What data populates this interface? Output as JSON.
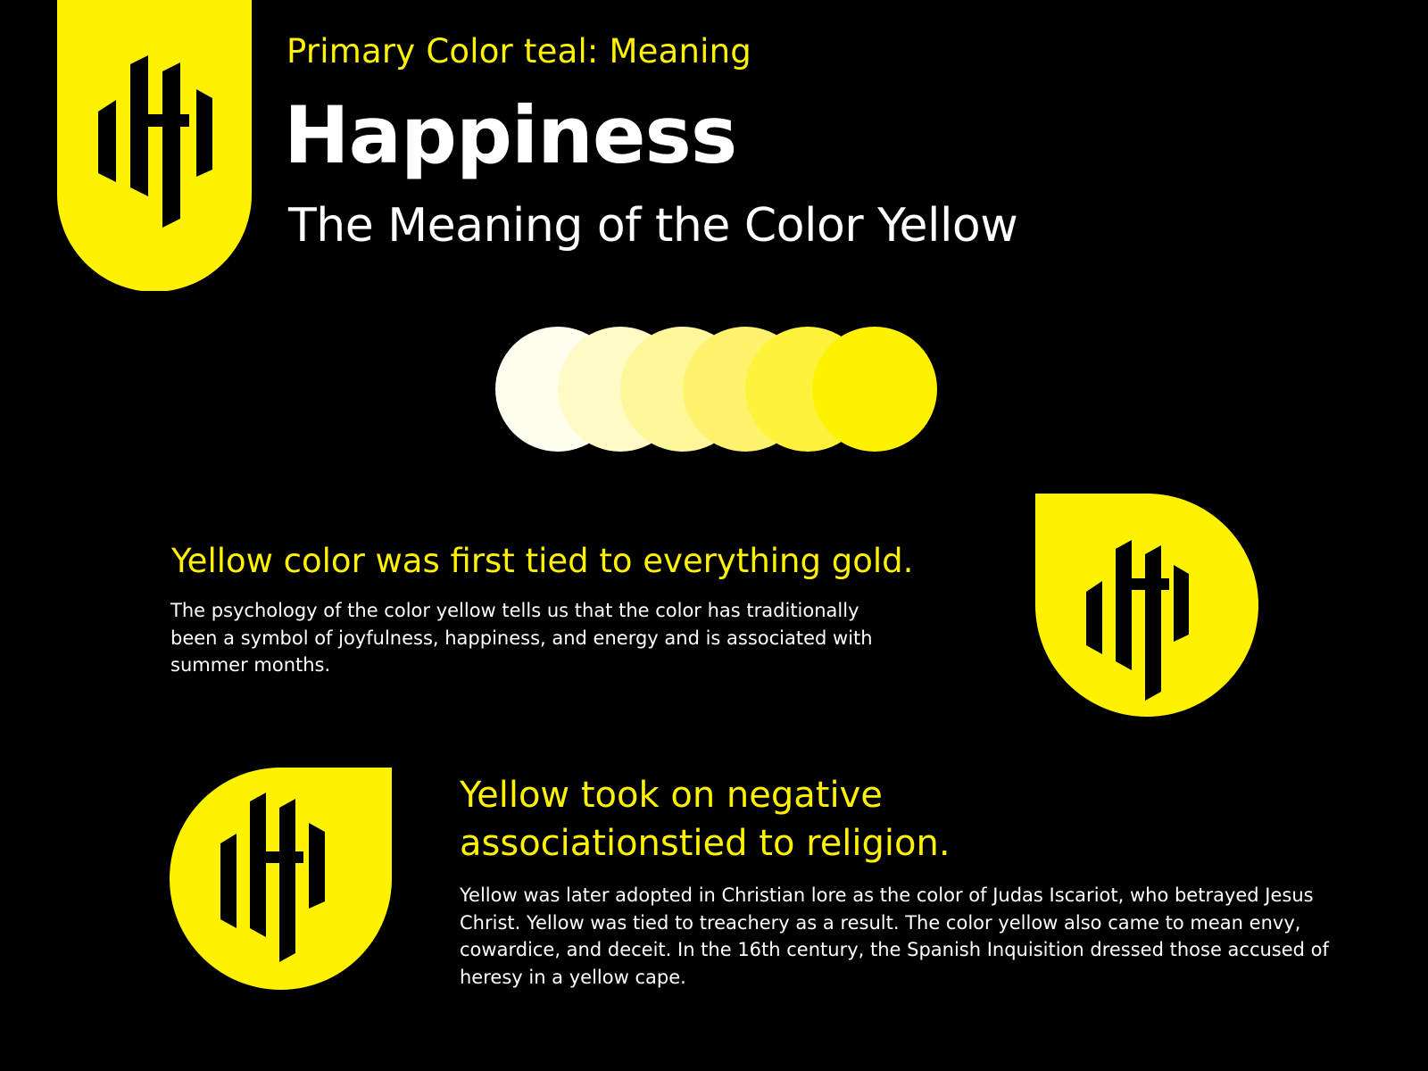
{
  "colors": {
    "accent": "#fff200",
    "background": "#000000",
    "text": "#ffffff"
  },
  "header": {
    "eyebrow": "Primary Color teal: Meaning",
    "title": "Happiness",
    "subtitle": "The Meaning of the Color Yellow"
  },
  "swatches": [
    "#fffded",
    "#fffac6",
    "#fff799",
    "#fff36d",
    "#fff23a",
    "#fff200"
  ],
  "sections": [
    {
      "heading": "Yellow color was first tied to everything gold.",
      "body": "The psychology of the color yellow tells us that the color has traditionally been a symbol of joyfulness, happiness, and energy and is associated with summer months."
    },
    {
      "heading": "Yellow took on negative associationstied to religion.",
      "body": "Yellow was later adopted in Christian lore as the color of Judas Iscariot, who betrayed Jesus Christ. Yellow was tied to treachery as a result. The color yellow also came to mean envy, cowardice, and deceit. In the 16th century, the Spanish Inquisition dressed those accused of heresy in a yellow cape."
    }
  ],
  "icons": [
    "brand-logo-icon"
  ]
}
